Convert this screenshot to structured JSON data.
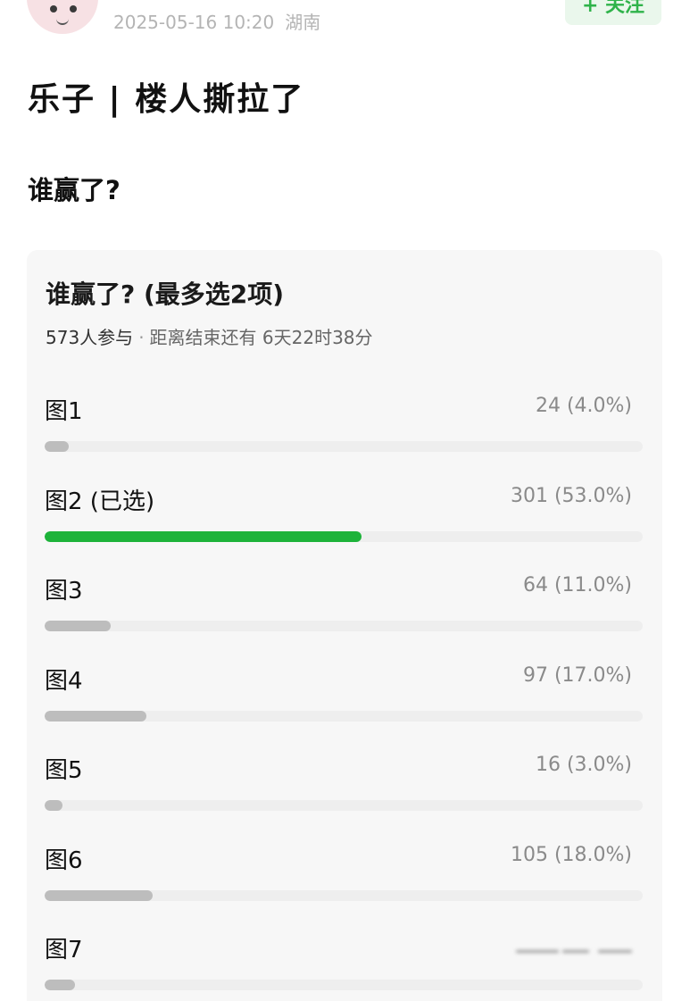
{
  "header": {
    "timestamp": "2025-05-16 10:20",
    "location": "湖南",
    "follow_label": "+ 关注"
  },
  "post": {
    "title": "乐子 | 楼人撕拉了",
    "body": "谁赢了?"
  },
  "poll": {
    "title": "谁赢了? (最多选2项)",
    "participants": "573人参与",
    "separator": "·",
    "remaining": "距离结束还有 6天22时38分",
    "colors": {
      "selected": "#1db33a",
      "unselected": "#bdbdbd",
      "track": "#eeeeee"
    },
    "options": [
      {
        "label": "图1",
        "count": "24 (4.0%)",
        "percent": 4.0,
        "selected": false
      },
      {
        "label": "图2 (已选)",
        "count": "301 (53.0%)",
        "percent": 53.0,
        "selected": true
      },
      {
        "label": "图3",
        "count": "64 (11.0%)",
        "percent": 11.0,
        "selected": false
      },
      {
        "label": "图4",
        "count": "97 (17.0%)",
        "percent": 17.0,
        "selected": false
      },
      {
        "label": "图5",
        "count": "16 (3.0%)",
        "percent": 3.0,
        "selected": false
      },
      {
        "label": "图6",
        "count": "105 (18.0%)",
        "percent": 18.0,
        "selected": false
      },
      {
        "label": "图7",
        "count": "",
        "percent": 5.0,
        "selected": false,
        "count_obscured": true
      }
    ]
  }
}
